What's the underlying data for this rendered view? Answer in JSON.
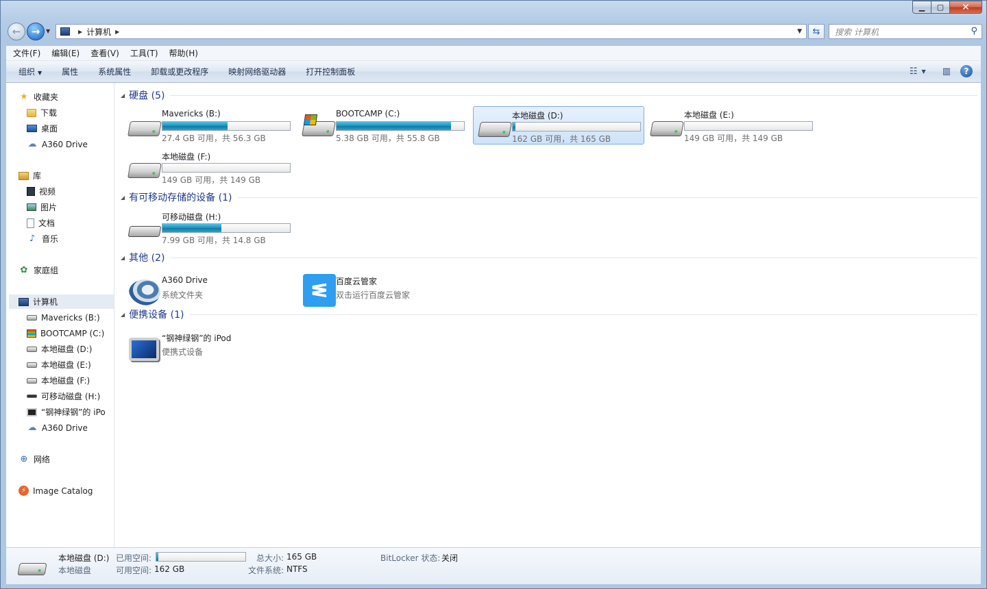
{
  "window": {
    "controls": {
      "minimize": "▁",
      "maximize": "▢",
      "close": "✕"
    }
  },
  "address": {
    "path": "计算机",
    "search_placeholder": "搜索 计算机"
  },
  "menu": [
    "文件(F)",
    "编辑(E)",
    "查看(V)",
    "工具(T)",
    "帮助(H)"
  ],
  "commands": [
    "组织",
    "属性",
    "系统属性",
    "卸载或更改程序",
    "映射网络驱动器",
    "打开控制面板"
  ],
  "nav": {
    "favorites": {
      "label": "收藏夹",
      "items": [
        "下载",
        "桌面",
        "A360 Drive"
      ]
    },
    "libraries": {
      "label": "库",
      "items": [
        "视频",
        "图片",
        "文档",
        "音乐"
      ]
    },
    "homegroup": "家庭组",
    "computer": {
      "label": "计算机",
      "items": [
        "Mavericks (B:)",
        "BOOTCAMP (C:)",
        "本地磁盘 (D:)",
        "本地磁盘 (E:)",
        "本地磁盘 (F:)",
        "可移动磁盘 (H:)",
        "“钢神绿钢”的 iPo",
        "A360 Drive"
      ]
    },
    "network": "网络",
    "image_catalog": "Image Catalog"
  },
  "groups": {
    "hdd": {
      "title": "硬盘 (5)",
      "drives": [
        {
          "name": "Mavericks (B:)",
          "info": "27.4 GB 可用，共 56.3 GB",
          "used_fraction": 0.51
        },
        {
          "name": "BOOTCAMP (C:)",
          "info": "5.38 GB 可用，共 55.8 GB",
          "used_fraction": 0.9
        },
        {
          "name": "本地磁盘 (D:)",
          "info": "162 GB 可用，共 165 GB",
          "used_fraction": 0.02
        },
        {
          "name": "本地磁盘 (E:)",
          "info": "149 GB 可用，共 149 GB",
          "used_fraction": 0.0
        },
        {
          "name": "本地磁盘 (F:)",
          "info": "149 GB 可用，共 149 GB",
          "used_fraction": 0.0
        }
      ]
    },
    "removable": {
      "title": "有可移动存储的设备 (1)",
      "drives": [
        {
          "name": "可移动磁盘 (H:)",
          "info": "7.99 GB 可用，共 14.8 GB",
          "used_fraction": 0.46
        }
      ]
    },
    "other": {
      "title": "其他 (2)",
      "items": [
        {
          "name": "A360 Drive",
          "desc": "系统文件夹"
        },
        {
          "name": "百度云管家",
          "desc": "双击运行百度云管家"
        }
      ]
    },
    "portable": {
      "title": "便携设备 (1)",
      "items": [
        {
          "name": "“钢神绿钢”的 iPod",
          "desc": "便携式设备"
        }
      ]
    }
  },
  "status": {
    "name": "本地磁盘 (D:)",
    "type": "本地磁盘",
    "used_label": "已用空间:",
    "used_fraction": 0.02,
    "free_label": "可用空间:",
    "free_value": "162 GB",
    "total_label": "总大小:",
    "total_value": "165 GB",
    "fs_label": "文件系统:",
    "fs_value": "NTFS",
    "bitlocker_label": "BitLocker 状态:",
    "bitlocker_value": "关闭"
  },
  "colors": {
    "accent": "#1e3a8a",
    "bar_fill": "#1a8fb8",
    "selection": "#cde3f9"
  }
}
